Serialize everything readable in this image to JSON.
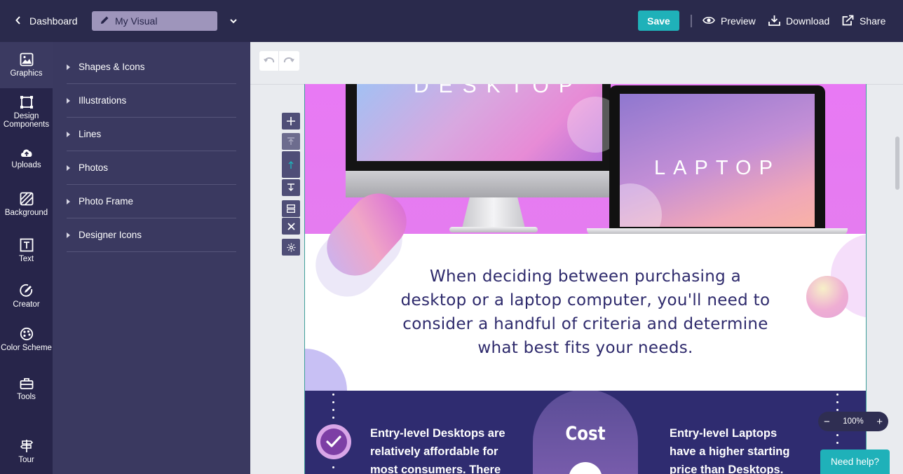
{
  "topbar": {
    "back_label": "Dashboard",
    "title_value": "My Visual",
    "save_label": "Save",
    "preview_label": "Preview",
    "download_label": "Download",
    "share_label": "Share"
  },
  "rail": {
    "graphics": "Graphics",
    "design_components": "Design Components",
    "uploads": "Uploads",
    "background": "Background",
    "text": "Text",
    "creator": "Creator",
    "color_scheme": "Color Scheme",
    "tools": "Tools",
    "tour": "Tour"
  },
  "panel": {
    "items": [
      {
        "label": "Shapes & Icons"
      },
      {
        "label": "Illustrations"
      },
      {
        "label": "Lines"
      },
      {
        "label": "Photos"
      },
      {
        "label": "Photo Frame"
      },
      {
        "label": "Designer Icons"
      }
    ]
  },
  "canvas": {
    "desktop_label": "DESKTOP",
    "laptop_label": "LAPTOP",
    "intro_text": "When deciding between purchasing a desktop or a laptop computer, you'll need to consider a handful of criteria and determine what best fits your needs.",
    "left_text": "Entry-level Desktops are relatively affordable for most consumers. There",
    "cost_label": "Cost",
    "right_text": "Entry-level Laptops have a higher starting price than Desktops."
  },
  "zoom": {
    "value": "100%"
  },
  "help_label": "Need help?",
  "colors": {
    "topbar": "#2a2a4c",
    "rail": "#27254a",
    "panel": "#3a3960",
    "accent": "#1fb1b9",
    "hero": "#e879f4",
    "band": "#2f2c70"
  }
}
